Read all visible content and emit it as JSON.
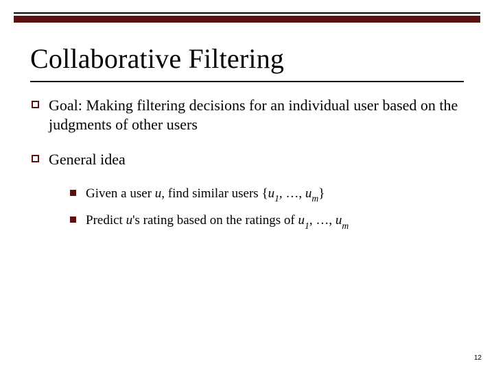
{
  "slide": {
    "title": "Collaborative Filtering",
    "bullets": [
      {
        "text": "Goal:  Making filtering decisions for an individual user based on the judgments of other users"
      },
      {
        "text": "General idea",
        "sub": [
          {
            "pre": "Given a user ",
            "u": "u",
            "mid1": ", find similar users {",
            "u1": "u",
            "s1": "1",
            "mid2": ", …, ",
            "um": "u",
            "sm": "m",
            "post": "}"
          },
          {
            "pre": "Predict ",
            "u": "u",
            "mid1": "'s rating based on the ratings of ",
            "u1": "u",
            "s1": "1",
            "mid2": ", …, ",
            "um": "u",
            "sm": "m",
            "post": ""
          }
        ]
      }
    ],
    "page_number": "12"
  }
}
